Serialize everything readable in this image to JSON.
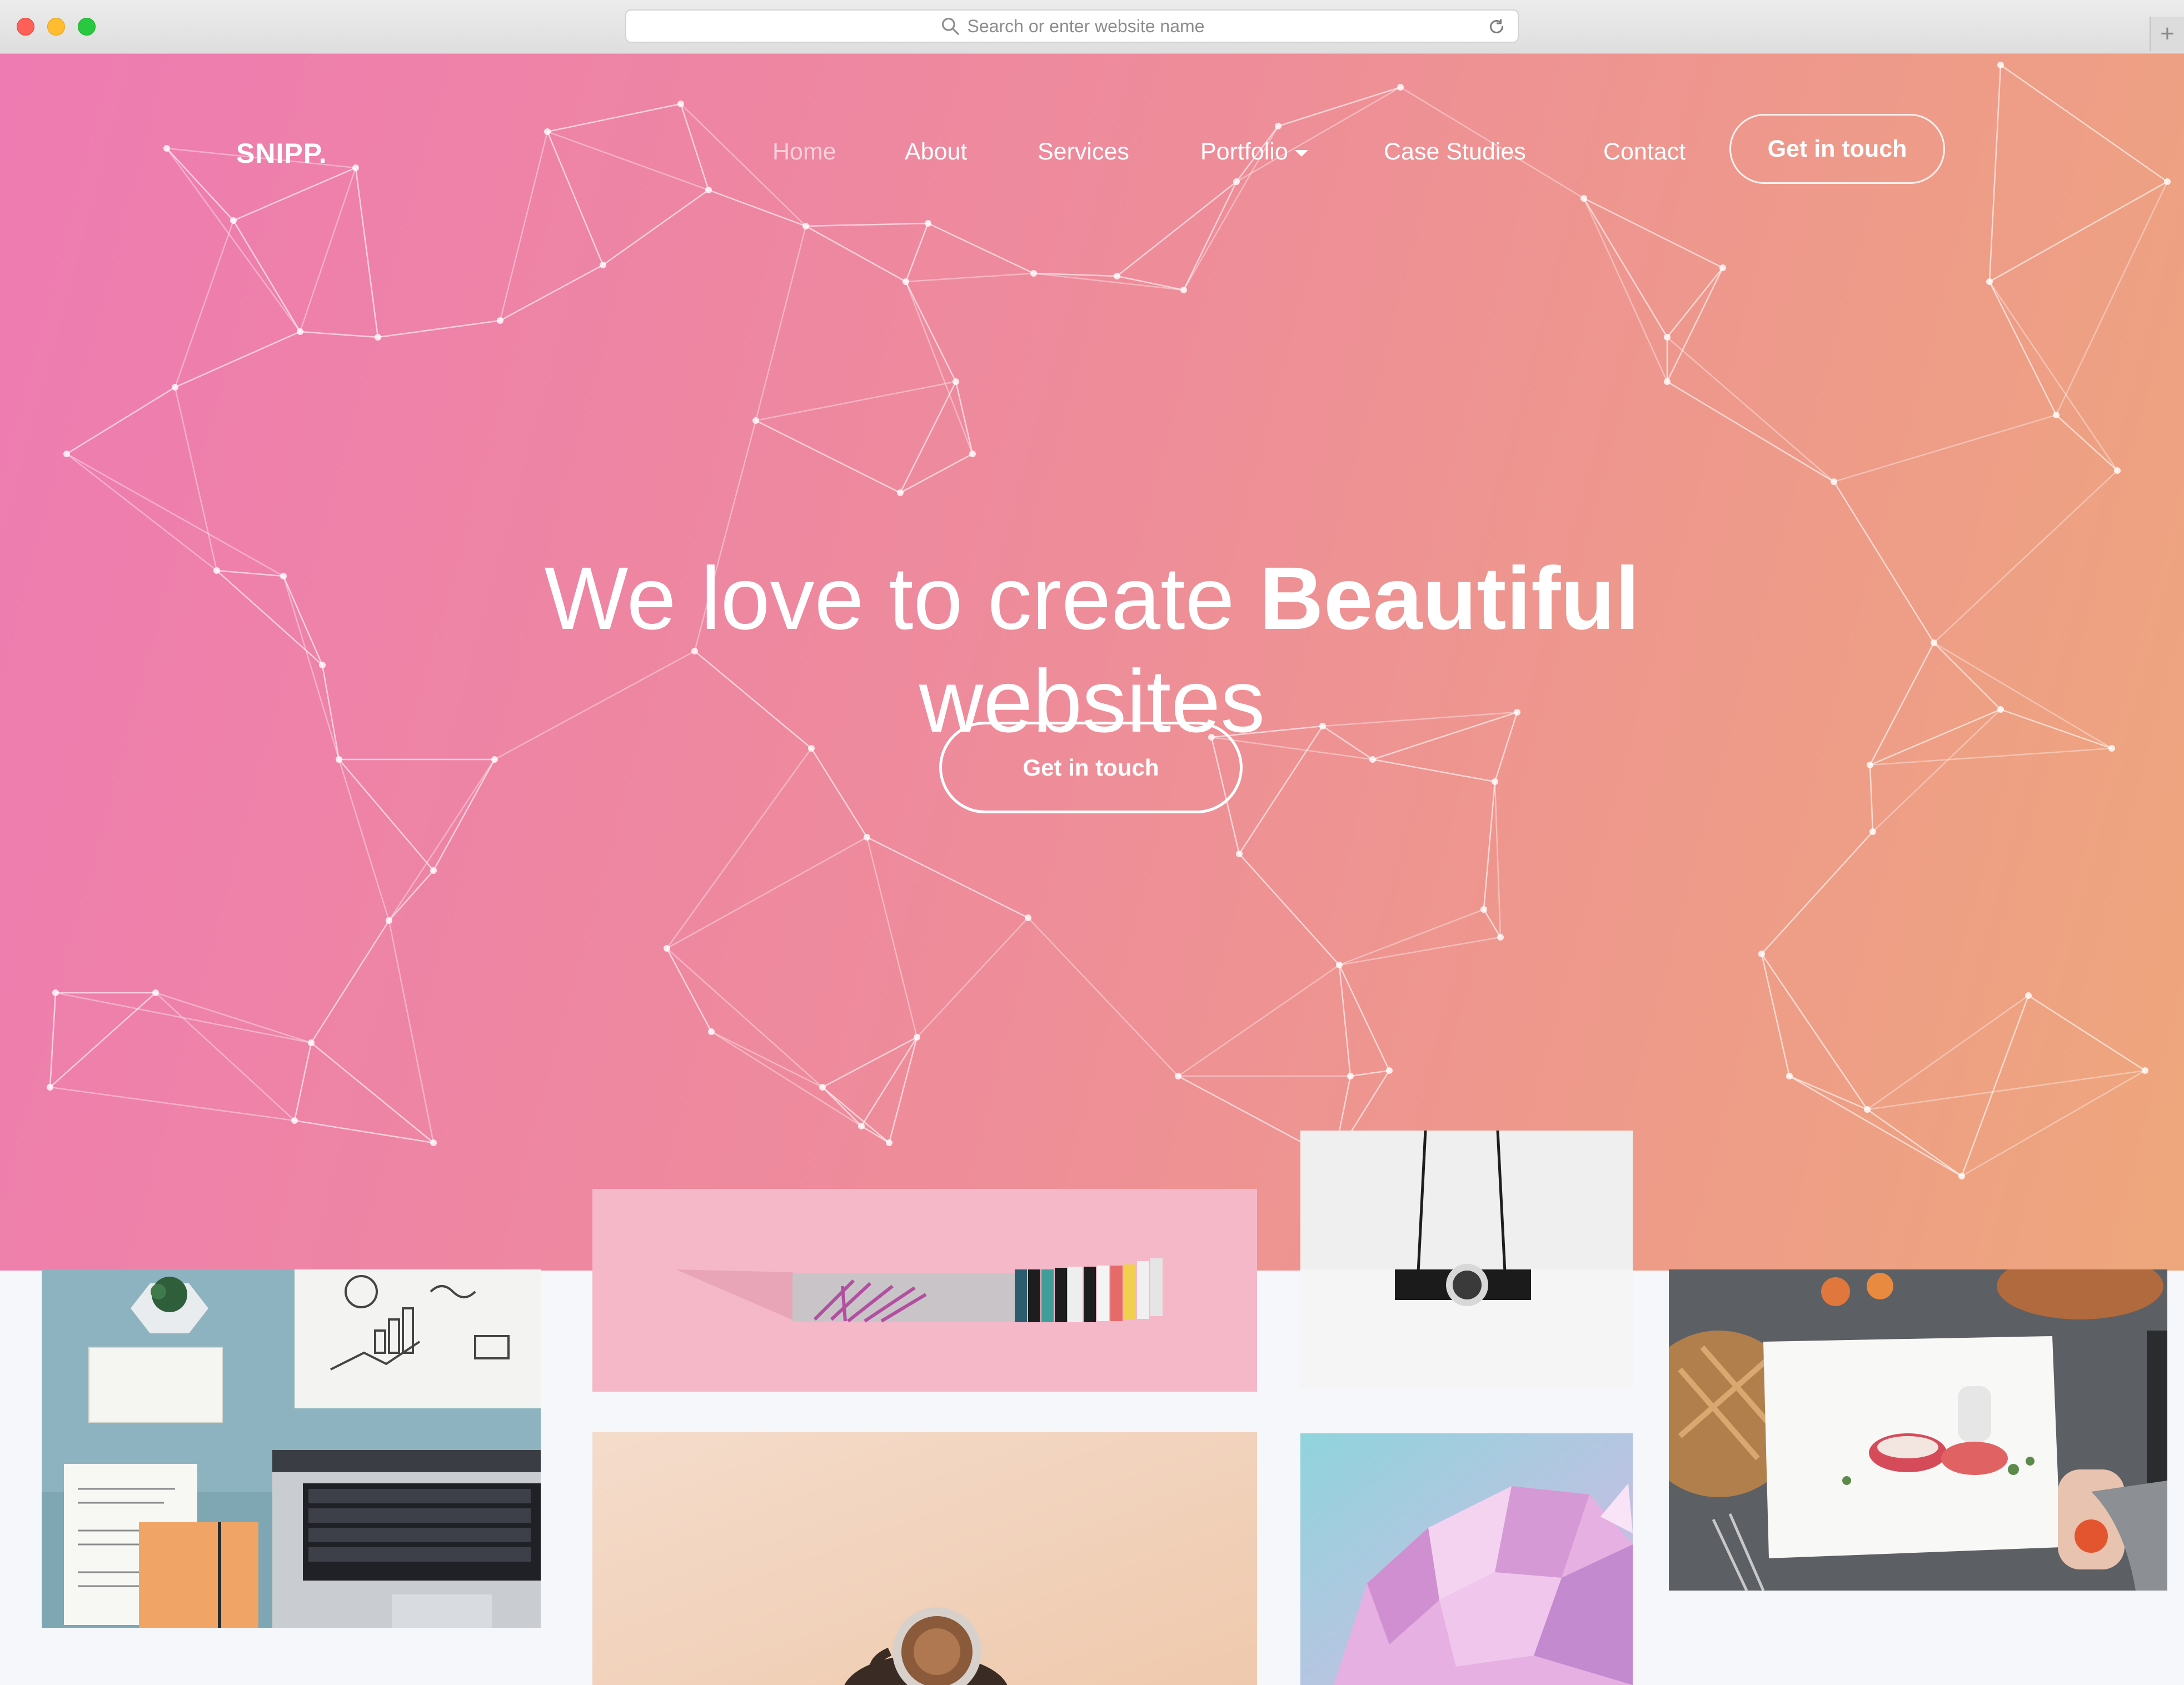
{
  "browser": {
    "url_placeholder": "Search or enter website name",
    "new_tab_symbol": "+",
    "icons": [
      "search-icon",
      "reload-icon",
      "new-tab-icon"
    ]
  },
  "site": {
    "logo": "SNIPP.",
    "nav": {
      "items": [
        {
          "label": "Home",
          "active": true
        },
        {
          "label": "About"
        },
        {
          "label": "Services"
        },
        {
          "label": "Portfolio",
          "dropdown": true
        },
        {
          "label": "Case Studies"
        },
        {
          "label": "Contact"
        }
      ],
      "cta": "Get in touch"
    },
    "hero": {
      "headline_light": "We love to create",
      "headline_bold": "Beautiful",
      "headline_line2": "websites",
      "cta": "Get in touch"
    },
    "gallery": [
      {
        "name": "workspace-laptop-photo"
      },
      {
        "name": "pink-books-photo"
      },
      {
        "name": "hanging-camera-photo"
      },
      {
        "name": "food-magazine-photo"
      },
      {
        "name": "coffee-cup-photo"
      },
      {
        "name": "pink-crystal-photo"
      }
    ]
  },
  "colors": {
    "gradient_left": "#ee7bb2",
    "gradient_mid": "#ee8c9a",
    "gradient_right": "#eea77c",
    "text_on_hero": "#ffffff",
    "page_background": "#f6f7fb"
  }
}
